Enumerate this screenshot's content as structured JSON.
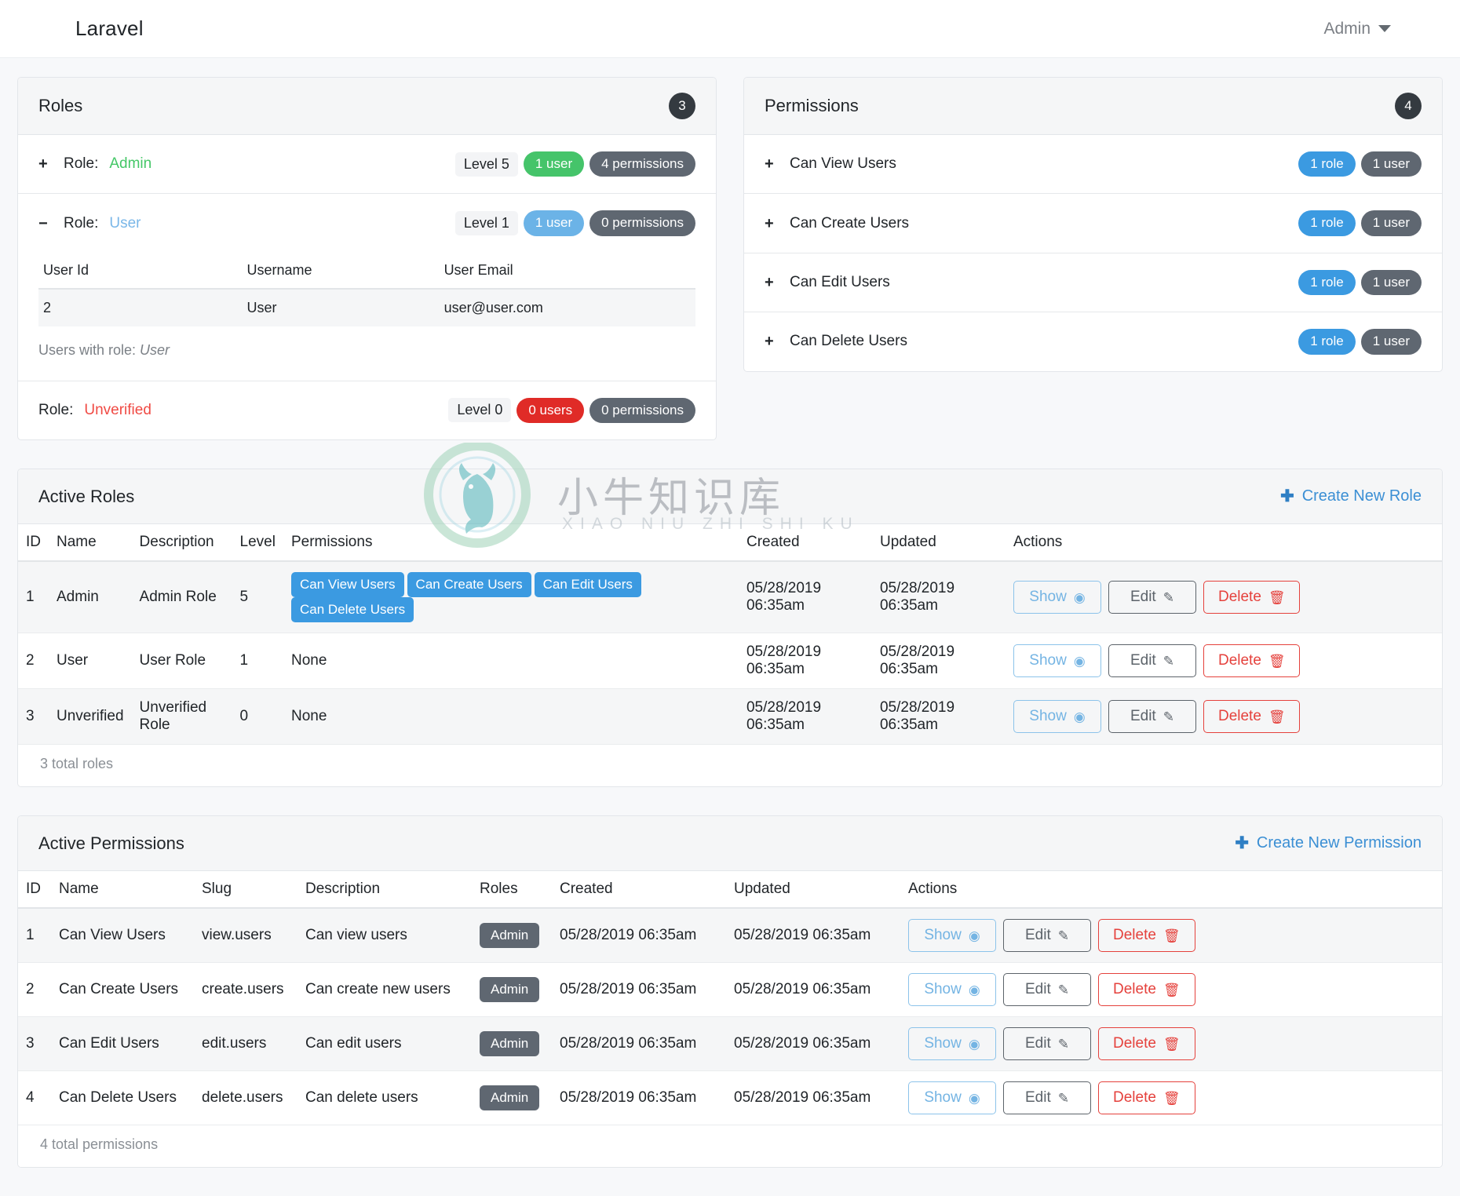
{
  "navbar": {
    "brand": "Laravel",
    "user": "Admin"
  },
  "roles_panel": {
    "title": "Roles",
    "count": "3",
    "items": [
      {
        "toggle": "+",
        "prefix": "Role:",
        "name": "Admin",
        "level": "Level 5",
        "users_badge": "1 user",
        "perms_badge": "4 permissions",
        "expanded": false
      },
      {
        "toggle": "−",
        "prefix": "Role:",
        "name": "User",
        "level": "Level 1",
        "users_badge": "1 user",
        "perms_badge": "0 permissions",
        "expanded": true,
        "table": {
          "headers": [
            "User Id",
            "Username",
            "User Email"
          ],
          "rows": [
            [
              "2",
              "User",
              "user@user.com"
            ]
          ]
        },
        "caption_prefix": "Users with role:",
        "caption_value": "User"
      },
      {
        "toggle": "",
        "prefix": "Role:",
        "name": "Unverified",
        "level": "Level 0",
        "users_badge": "0 users",
        "perms_badge": "0 permissions",
        "expanded": false
      }
    ]
  },
  "permissions_panel": {
    "title": "Permissions",
    "count": "4",
    "items": [
      {
        "toggle": "+",
        "name": "Can View Users",
        "roles_badge": "1 role",
        "users_badge": "1 user"
      },
      {
        "toggle": "+",
        "name": "Can Create Users",
        "roles_badge": "1 role",
        "users_badge": "1 user"
      },
      {
        "toggle": "+",
        "name": "Can Edit Users",
        "roles_badge": "1 role",
        "users_badge": "1 user"
      },
      {
        "toggle": "+",
        "name": "Can Delete Users",
        "roles_badge": "1 role",
        "users_badge": "1 user"
      }
    ]
  },
  "active_roles": {
    "title": "Active Roles",
    "create_label": "Create New Role",
    "headers": [
      "ID",
      "Name",
      "Description",
      "Level",
      "Permissions",
      "Created",
      "Updated",
      "Actions"
    ],
    "rows": [
      {
        "id": "1",
        "name": "Admin",
        "description": "Admin Role",
        "level": "5",
        "permissions": [
          "Can View Users",
          "Can Create Users",
          "Can Edit Users",
          "Can Delete Users"
        ],
        "permissions_none": "",
        "created": "05/28/2019 06:35am",
        "updated": "05/28/2019 06:35am"
      },
      {
        "id": "2",
        "name": "User",
        "description": "User Role",
        "level": "1",
        "permissions": [],
        "permissions_none": "None",
        "created": "05/28/2019 06:35am",
        "updated": "05/28/2019 06:35am"
      },
      {
        "id": "3",
        "name": "Unverified",
        "description": "Unverified Role",
        "level": "0",
        "permissions": [],
        "permissions_none": "None",
        "created": "05/28/2019 06:35am",
        "updated": "05/28/2019 06:35am"
      }
    ],
    "actions": {
      "show": "Show",
      "edit": "Edit",
      "delete": "Delete"
    },
    "footer": "3 total roles"
  },
  "active_permissions": {
    "title": "Active Permissions",
    "create_label": "Create New Permission",
    "headers": [
      "ID",
      "Name",
      "Slug",
      "Description",
      "Roles",
      "Created",
      "Updated",
      "Actions"
    ],
    "rows": [
      {
        "id": "1",
        "name": "Can View Users",
        "slug": "view.users",
        "description": "Can view users",
        "role": "Admin",
        "created": "05/28/2019 06:35am",
        "updated": "05/28/2019 06:35am"
      },
      {
        "id": "2",
        "name": "Can Create Users",
        "slug": "create.users",
        "description": "Can create new users",
        "role": "Admin",
        "created": "05/28/2019 06:35am",
        "updated": "05/28/2019 06:35am"
      },
      {
        "id": "3",
        "name": "Can Edit Users",
        "slug": "edit.users",
        "description": "Can edit users",
        "role": "Admin",
        "created": "05/28/2019 06:35am",
        "updated": "05/28/2019 06:35am"
      },
      {
        "id": "4",
        "name": "Can Delete Users",
        "slug": "delete.users",
        "description": "Can delete users",
        "role": "Admin",
        "created": "05/28/2019 06:35am",
        "updated": "05/28/2019 06:35am"
      }
    ],
    "actions": {
      "show": "Show",
      "edit": "Edit",
      "delete": "Delete"
    },
    "footer": "4 total permissions"
  },
  "watermark": {
    "text": "小牛知识库",
    "subtext": "XIAO NIU ZHI SHI KU"
  },
  "icons": {
    "eye": "◉",
    "pencil": "✎",
    "trash": "Ὕ1",
    "plus": "✚"
  },
  "colors": {
    "accent": "#3b9ae1",
    "success": "#45c46a",
    "danger": "#e02b27",
    "dark": "#343a40",
    "gray": "#5f6771"
  }
}
